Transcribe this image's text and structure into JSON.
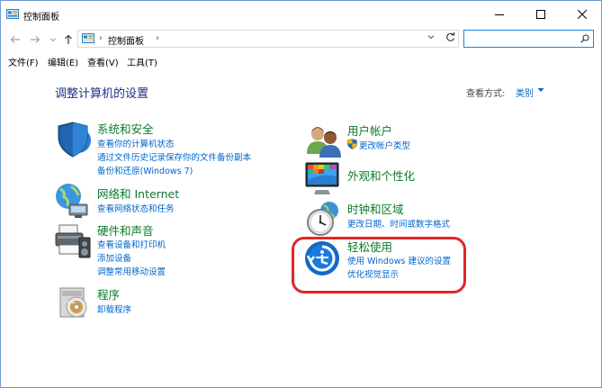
{
  "window": {
    "title": "控制面板"
  },
  "address_bar": {
    "crumb_separator": "›",
    "crumb": "控制面板",
    "search_placeholder": ""
  },
  "menu": [
    {
      "label": "文件(F)"
    },
    {
      "label": "编辑(E)"
    },
    {
      "label": "查看(V)"
    },
    {
      "label": "工具(T)"
    }
  ],
  "page": {
    "title": "调整计算机的设置",
    "view_by_label": "查看方式:",
    "view_by_value": "类别"
  },
  "categories": {
    "system": {
      "title": "系统和安全",
      "icon": "shield-globe-icon",
      "links": [
        "查看你的计算机状态",
        "通过文件历史记录保存你的文件备份副本",
        "备份和还原(Windows 7)"
      ]
    },
    "network": {
      "title": "网络和 Internet",
      "icon": "network-globe-icon",
      "links": [
        "查看网络状态和任务"
      ]
    },
    "hardware": {
      "title": "硬件和声音",
      "icon": "printer-speaker-icon",
      "links": [
        "查看设备和打印机",
        "添加设备",
        "调整常用移动设置"
      ]
    },
    "programs": {
      "title": "程序",
      "icon": "programs-disc-icon",
      "links": [
        "卸载程序"
      ]
    },
    "user_accounts": {
      "title": "用户帐户",
      "icon": "users-icon",
      "links": [
        "更改帐户类型"
      ]
    },
    "appearance": {
      "title": "外观和个性化",
      "icon": "monitor-color-icon",
      "links": []
    },
    "clock": {
      "title": "时钟和区域",
      "icon": "clock-globe-icon",
      "links": [
        "更改日期、时间或数字格式"
      ]
    },
    "ease_of_access": {
      "title": "轻松使用",
      "icon": "ease-of-access-icon",
      "links": [
        "使用 Windows 建议的设置",
        "优化视觉显示"
      ]
    }
  },
  "colors": {
    "link": "#0066cc",
    "category_title": "#0b7a2e",
    "heading": "#1e3287",
    "highlight": "#e22626"
  }
}
